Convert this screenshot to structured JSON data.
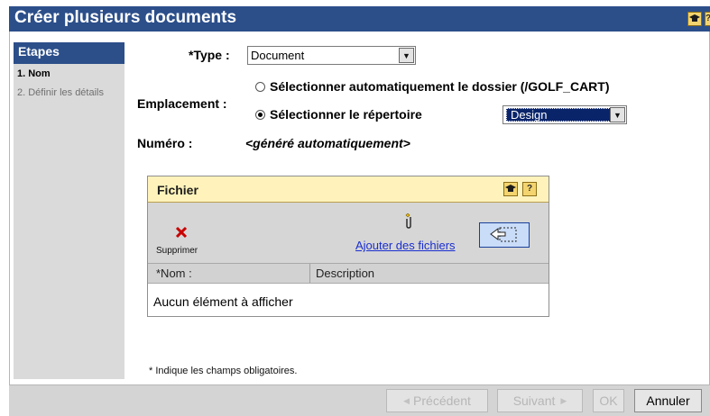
{
  "window": {
    "title": "Créer plusieurs documents",
    "help_label": "?",
    "help_label_partial": "?"
  },
  "steps": {
    "header": "Etapes",
    "items": [
      {
        "label": "1. Nom",
        "active": true
      },
      {
        "label": "2. Définir les détails",
        "active": false
      }
    ]
  },
  "form": {
    "type_label": "*Type :",
    "type_value": "Document",
    "location_label": "Emplacement :",
    "radio_auto_label": "Sélectionner automatiquement le dossier  (/GOLF_CART)",
    "radio_dir_label": "Sélectionner le répertoire",
    "directory_value": "Design",
    "number_label": "Numéro :",
    "number_value": "<généré automatiquement>"
  },
  "files_panel": {
    "title": "Fichier",
    "help_label": "?",
    "delete_label": "Supprimer",
    "add_files_label": "Ajouter des fichiers",
    "columns": [
      "*Nom :",
      "Description"
    ],
    "empty_text": "Aucun élément à afficher"
  },
  "footer": {
    "required_note": "* Indique les champs obligatoires."
  },
  "buttons": {
    "previous": "Précédent",
    "next": "Suivant",
    "ok": "OK",
    "cancel": "Annuler"
  },
  "colors": {
    "title_bar": "#2c4f8a",
    "panel_header": "#fff3bb",
    "link": "#1a2ed0",
    "delete_icon": "#c80000",
    "selected_dropdown": "#0a246a"
  }
}
